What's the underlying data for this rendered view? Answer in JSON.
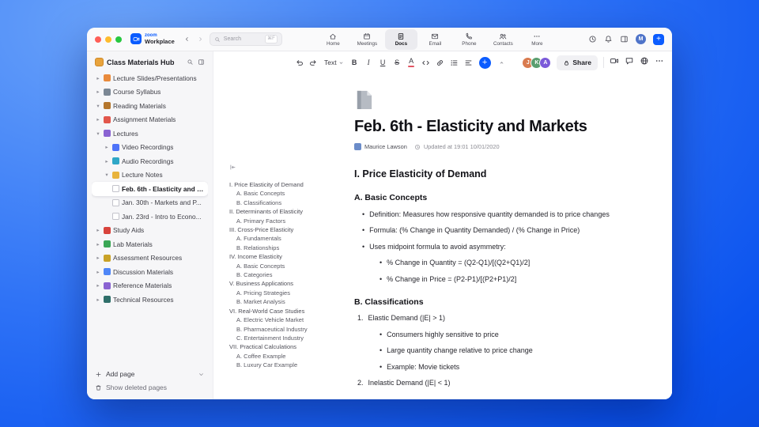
{
  "colors": {
    "accent": "#0b5cff",
    "window_controls": [
      "#ff5f57",
      "#febc2e",
      "#28c840"
    ],
    "selection_bg": "#ffffff"
  },
  "titlebar": {
    "brand_top": "zoom",
    "brand_bottom": "Workplace",
    "search": {
      "placeholder": "Search",
      "shortcut": "⌘F"
    },
    "tabs": [
      {
        "label": "Home",
        "icon": "home-icon",
        "active": false
      },
      {
        "label": "Meetings",
        "icon": "meetings-icon",
        "active": false
      },
      {
        "label": "Docs",
        "icon": "docs-icon",
        "active": true
      },
      {
        "label": "Email",
        "icon": "email-icon",
        "active": false
      },
      {
        "label": "Phone",
        "icon": "phone-icon",
        "active": false
      },
      {
        "label": "Contacts",
        "icon": "contacts-icon",
        "active": false
      },
      {
        "label": "More",
        "icon": "more-icon",
        "active": false
      }
    ],
    "user_initial": "M"
  },
  "sidebar": {
    "title": "Class Materials Hub",
    "items": [
      {
        "label": "Lecture Slides/Presentations",
        "level": 0,
        "chevron": "collapsed",
        "icon": "presentation-icon",
        "icon_color": "#e98a3c",
        "selected": false
      },
      {
        "label": "Course Syllabus",
        "level": 0,
        "chevron": "collapsed",
        "icon": "syllabus-icon",
        "icon_color": "#7b8794",
        "selected": false
      },
      {
        "label": "Reading Materials",
        "level": 0,
        "chevron": "expanded",
        "icon": "open-book-icon",
        "icon_color": "#b4762c",
        "selected": false
      },
      {
        "label": "Assignment Materials",
        "level": 0,
        "chevron": "collapsed",
        "icon": "pencil-icon",
        "icon_color": "#e2574c",
        "selected": false
      },
      {
        "label": "Lectures",
        "level": 0,
        "chevron": "expanded",
        "icon": "lectures-icon",
        "icon_color": "#8a63d2",
        "selected": false
      },
      {
        "label": "Video Recordings",
        "level": 1,
        "chevron": "collapsed",
        "icon": "video-icon",
        "icon_color": "#4f74f9",
        "selected": false
      },
      {
        "label": "Audio Recordings",
        "level": 1,
        "chevron": "collapsed",
        "icon": "audio-icon",
        "icon_color": "#2fa7c7",
        "selected": false
      },
      {
        "label": "Lecture Notes",
        "level": 1,
        "chevron": "expanded",
        "icon": "notes-icon",
        "icon_color": "#e8b33c",
        "selected": false
      },
      {
        "label": "Feb. 6th - Elasticity and M...",
        "level": 2,
        "chevron": "none",
        "icon": "page-icon",
        "icon_color": "",
        "selected": true
      },
      {
        "label": "Jan. 30th - Markets and P...",
        "level": 2,
        "chevron": "none",
        "icon": "page-icon",
        "icon_color": "",
        "selected": false
      },
      {
        "label": "Jan. 23rd - Intro to Econo...",
        "level": 2,
        "chevron": "none",
        "icon": "page-icon",
        "icon_color": "",
        "selected": false
      },
      {
        "label": "Study Aids",
        "level": 0,
        "chevron": "collapsed",
        "icon": "study-icon",
        "icon_color": "#d8433c",
        "selected": false
      },
      {
        "label": "Lab Materials",
        "level": 0,
        "chevron": "collapsed",
        "icon": "lab-icon",
        "icon_color": "#3aa655",
        "selected": false
      },
      {
        "label": "Assessment Resources",
        "level": 0,
        "chevron": "collapsed",
        "icon": "assessment-icon",
        "icon_color": "#c9a227",
        "selected": false
      },
      {
        "label": "Discussion Materials",
        "level": 0,
        "chevron": "collapsed",
        "icon": "discussion-icon",
        "icon_color": "#4f86f7",
        "selected": false
      },
      {
        "label": "Reference Materials",
        "level": 0,
        "chevron": "collapsed",
        "icon": "reference-icon",
        "icon_color": "#8a63d2",
        "selected": false
      },
      {
        "label": "Technical Resources",
        "level": 0,
        "chevron": "collapsed",
        "icon": "technical-icon",
        "icon_color": "#2f6f6a",
        "selected": false
      }
    ],
    "add_page_label": "Add page",
    "show_deleted_label": "Show deleted pages"
  },
  "toolbar": {
    "text_style_label": "Text",
    "share_label": "Share",
    "collaborators": [
      {
        "initials": "J",
        "color": "#d97b4f"
      },
      {
        "initials": "K",
        "color": "#5a9e6f"
      },
      {
        "initials": "A",
        "color": "#7b5ad9"
      }
    ]
  },
  "doc": {
    "title": "Feb. 6th - Elasticity and Markets",
    "author": "Maurice Lawson",
    "updated": "Updated at 19:01 10/01/2020",
    "outline": [
      {
        "text": "I. Price Elasticity of Demand",
        "level": 0
      },
      {
        "text": "A. Basic Concepts",
        "level": 1
      },
      {
        "text": "B. Classifications",
        "level": 1
      },
      {
        "text": "II. Determinants of Elasticity",
        "level": 0
      },
      {
        "text": "A. Primary Factors",
        "level": 1
      },
      {
        "text": "III. Cross-Price Elasticity",
        "level": 0
      },
      {
        "text": "A. Fundamentals",
        "level": 1
      },
      {
        "text": "B. Relationships",
        "level": 1
      },
      {
        "text": "IV. Income Elasticity",
        "level": 0
      },
      {
        "text": "A. Basic Concepts",
        "level": 1
      },
      {
        "text": "B. Categories",
        "level": 1
      },
      {
        "text": "V. Business Applications",
        "level": 0
      },
      {
        "text": "A. Pricing Strategies",
        "level": 1
      },
      {
        "text": "B. Market Analysis",
        "level": 1
      },
      {
        "text": "VI. Real-World Case Studies",
        "level": 0
      },
      {
        "text": "A. Electric Vehicle Market",
        "level": 1
      },
      {
        "text": "B. Pharmaceutical Industry",
        "level": 1
      },
      {
        "text": "C. Entertainment Industry",
        "level": 1
      },
      {
        "text": "VII. Practical Calculations",
        "level": 0
      },
      {
        "text": "A. Coffee Example",
        "level": 1
      },
      {
        "text": "B. Luxury Car Example",
        "level": 1
      }
    ],
    "blocks": [
      {
        "type": "h2",
        "text": "I. Price Elasticity of Demand"
      },
      {
        "type": "h3",
        "text": "A. Basic Concepts"
      },
      {
        "type": "bullet",
        "level": 0,
        "text": "Definition: Measures how responsive quantity demanded is to price changes"
      },
      {
        "type": "bullet",
        "level": 0,
        "text": "Formula: (% Change in Quantity Demanded) / (% Change in Price)"
      },
      {
        "type": "bullet",
        "level": 0,
        "text": "Uses midpoint formula to avoid asymmetry:"
      },
      {
        "type": "bullet",
        "level": 1,
        "text": "% Change in Quantity = (Q2-Q1)/[(Q2+Q1)/2]"
      },
      {
        "type": "bullet",
        "level": 1,
        "text": "% Change in Price = (P2-P1)/[(P2+P1)/2]"
      },
      {
        "type": "h3",
        "text": "B. Classifications"
      },
      {
        "type": "number",
        "num": "1.",
        "text": "Elastic Demand (|E| > 1)"
      },
      {
        "type": "bullet",
        "level": 1,
        "text": "Consumers highly sensitive to price"
      },
      {
        "type": "bullet",
        "level": 1,
        "text": "Large quantity change relative to price change"
      },
      {
        "type": "bullet",
        "level": 1,
        "text": "Example: Movie tickets"
      },
      {
        "type": "number",
        "num": "2.",
        "text": "Inelastic Demand (|E| < 1)"
      }
    ]
  }
}
